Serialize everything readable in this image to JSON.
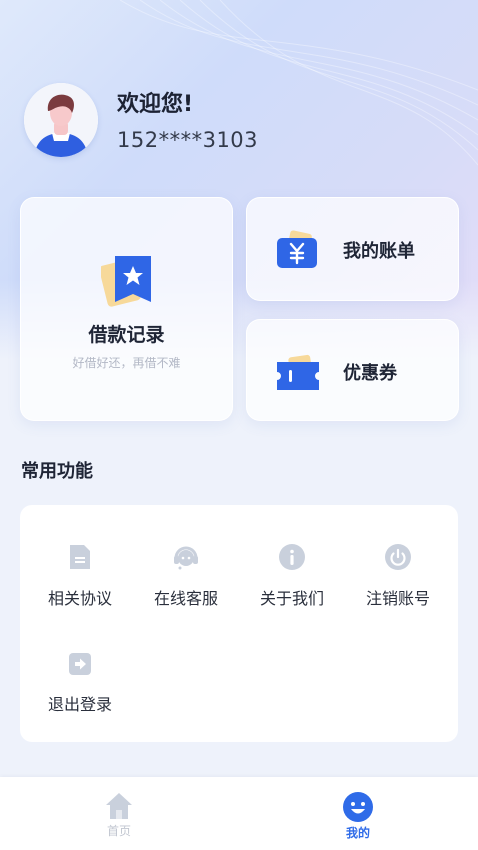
{
  "profile": {
    "welcome": "欢迎您!",
    "phone": "152****3103"
  },
  "cards": {
    "loan_title": "借款记录",
    "loan_subtitle": "好借好还，再借不难",
    "bill_title": "我的账单",
    "coupon_title": "优惠券"
  },
  "common": {
    "title": "常用功能",
    "items": [
      {
        "label": "相关协议",
        "icon": "document-icon"
      },
      {
        "label": "在线客服",
        "icon": "headset-icon"
      },
      {
        "label": "关于我们",
        "icon": "info-icon"
      },
      {
        "label": "注销账号",
        "icon": "power-icon"
      },
      {
        "label": "退出登录",
        "icon": "logout-icon"
      }
    ]
  },
  "tabbar": {
    "home": "首页",
    "mine": "我的"
  },
  "colors": {
    "accent": "#2f6be8",
    "icon_gray": "#c9d0dc"
  }
}
